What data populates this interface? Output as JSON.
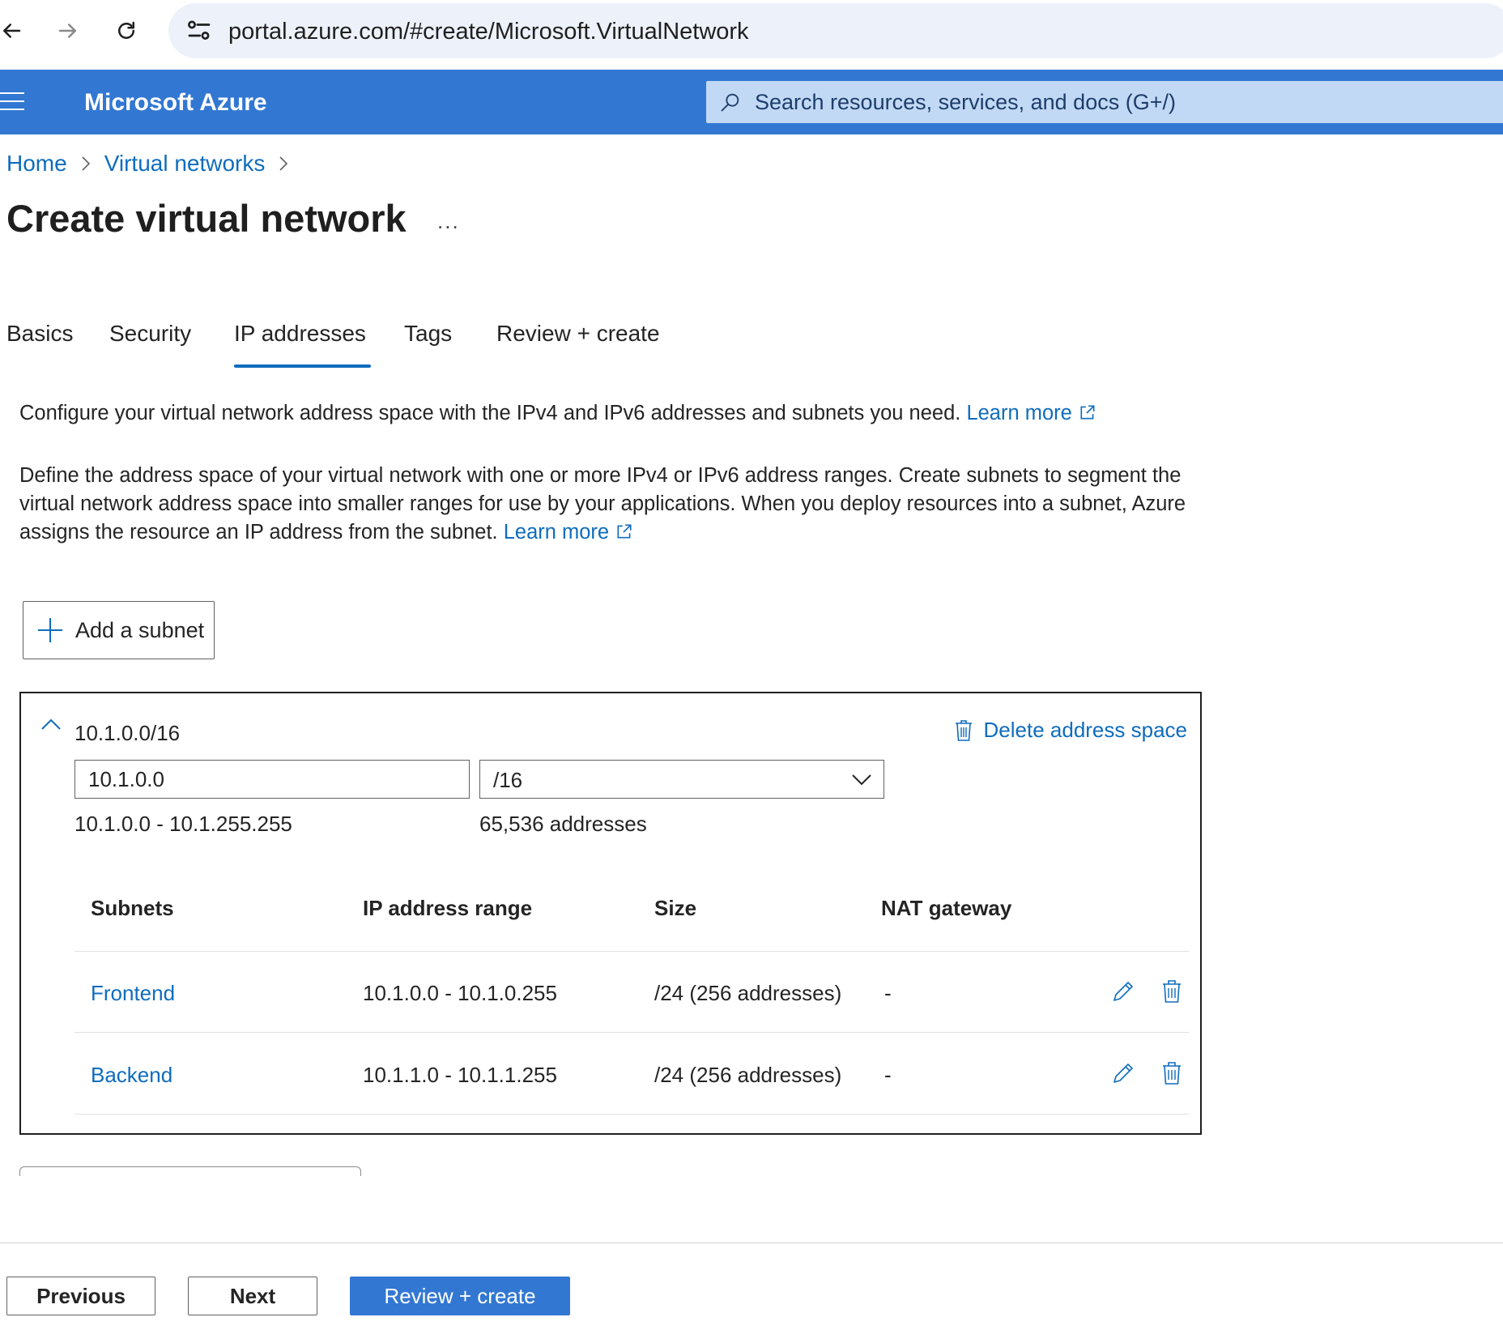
{
  "browser": {
    "url": "portal.azure.com/#create/Microsoft.VirtualNetwork"
  },
  "header": {
    "brand": "Microsoft Azure",
    "search_placeholder": "Search resources, services, and docs (G+/)"
  },
  "breadcrumb": {
    "items": [
      "Home",
      "Virtual networks"
    ]
  },
  "page": {
    "title": "Create virtual network",
    "more": "..."
  },
  "tabs": [
    {
      "label": "Basics"
    },
    {
      "label": "Security"
    },
    {
      "label": "IP addresses",
      "active": true
    },
    {
      "label": "Tags"
    },
    {
      "label": "Review + create"
    }
  ],
  "description": {
    "line1": "Configure your virtual network address space with the IPv4 and IPv6 addresses and subnets you need.",
    "line2": "Define the address space of your virtual network with one or more IPv4 or IPv6 address ranges. Create subnets to segment the virtual network address space into smaller ranges for use by your applications. When you deploy resources into a subnet, Azure assigns the resource an IP address from the subnet.",
    "learn_more": "Learn more"
  },
  "add_subnet_label": "Add a subnet",
  "address_space": {
    "title": "10.1.0.0/16",
    "delete_label": "Delete address space",
    "address_value": "10.1.0.0",
    "prefix_value": "/16",
    "range": "10.1.0.0 - 10.1.255.255",
    "count": "65,536 addresses",
    "table": {
      "headers": [
        "Subnets",
        "IP address range",
        "Size",
        "NAT gateway"
      ],
      "rows": [
        {
          "name": "Frontend",
          "range": "10.1.0.0 - 10.1.0.255",
          "size": "/24 (256 addresses)",
          "nat": "-"
        },
        {
          "name": "Backend",
          "range": "10.1.1.0 - 10.1.1.255",
          "size": "/24 (256 addresses)",
          "nat": "-"
        }
      ]
    }
  },
  "footer": {
    "previous": "Previous",
    "next": "Next",
    "review_create": "Review + create"
  },
  "colors": {
    "azure_blue": "#3277d2",
    "link_blue": "#0f6cbd",
    "search_bg": "#c1d9f4",
    "url_bar_bg": "#edf2fa"
  }
}
